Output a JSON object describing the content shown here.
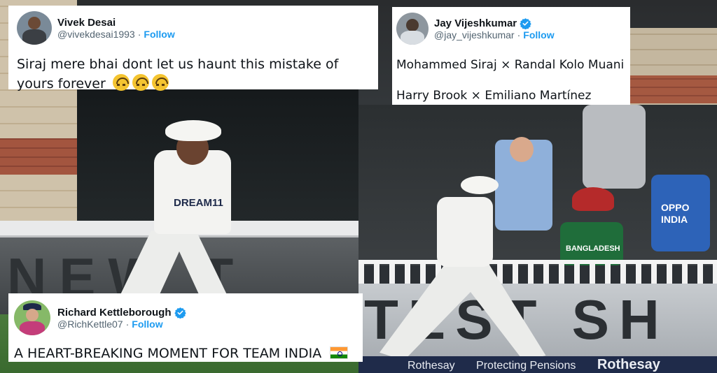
{
  "tweets": {
    "vivek": {
      "display_name": "Vivek Desai",
      "handle": "@vivekdesai1993",
      "separator": "·",
      "follow_label": "Follow",
      "verified": false,
      "text": "Siraj mere bhai dont let us haunt this mistake of yours forever",
      "emoji": [
        "upside-down-face",
        "upside-down-face",
        "upside-down-face"
      ]
    },
    "jay": {
      "display_name": "Jay Vijeshkumar",
      "handle": "@jay_vijeshkumar",
      "separator": "·",
      "follow_label": "Follow",
      "verified": true,
      "line1": "Mohammed Siraj × Randal Kolo Muani",
      "line2": "Harry Brook × Emiliano Martínez"
    },
    "richard": {
      "display_name": "Richard Kettleborough",
      "handle": "@RichKettle07",
      "separator": "·",
      "follow_label": "Follow",
      "verified": true,
      "text": "A HEART-BREAKING MOMENT FOR TEAM INDIA",
      "emoji": [
        "india-flag"
      ]
    }
  },
  "photos": {
    "left": {
      "jersey_text": "DREAM11",
      "board_text": "NEW T"
    },
    "right": {
      "board_text": "TEST SH",
      "jersey_text_fan": "BANGLADESH",
      "jersey_text_india_1": "OPPO",
      "jersey_text_india_2": "INDIA",
      "strip_items": [
        "Rothesay",
        "Protecting Pensions",
        "Rothesay"
      ]
    }
  },
  "colors": {
    "follow": "#1d9bf0",
    "verified": "#1d9bf0",
    "handle": "#536471",
    "text": "#0f1419"
  }
}
